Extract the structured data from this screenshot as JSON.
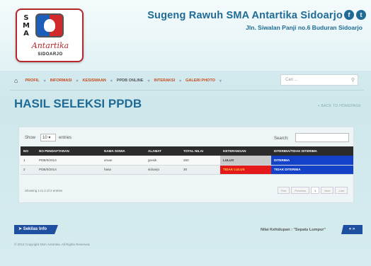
{
  "header": {
    "title": "Sugeng Rawuh SMA Antartika Sidoarjo",
    "address": "Jln. Siwalan Panji no.6 Buduran Sidoarjo",
    "social": [
      "f",
      "t"
    ]
  },
  "logo": {
    "letters": "SMA",
    "script": "Antartika",
    "city": "SIDOARJO"
  },
  "nav": {
    "home_icon": "home-icon",
    "items": [
      "PROFIL",
      "INFORMASI",
      "KESISWAAN",
      "PPDB ONLINE",
      "INTERAKSI",
      "GALERI PHOTO"
    ],
    "search_placeholder": "Cari ..."
  },
  "page": {
    "title": "HASIL SELEKSI PPDB",
    "back_link": "« BACK TO HOMEPAGE"
  },
  "table": {
    "show_label": "Show",
    "show_value": "10",
    "entries_label": "entries",
    "search_label": "Search:",
    "columns": [
      "NO",
      "NO PENDAFTARAN",
      "NAMA SISWA",
      "ALAMAT",
      "TOTAL NILAI",
      "KETERANGAN",
      "DITERIMA/TIDAK DITERIMA"
    ],
    "rows": [
      [
        "1",
        "PDB/0/2014",
        "ervan",
        "gresik",
        "260",
        "LULUS",
        "DITERIMA"
      ],
      [
        "2",
        "PDB/0/2014",
        "hasa",
        "sidoarjo",
        "30",
        "TIDAK LULUS",
        "TIDAK DITERIMA"
      ]
    ],
    "showing": "Showing 1 to 2 of 2 entries",
    "pager": [
      "First",
      "Previous",
      "1",
      "Next",
      "Last"
    ]
  },
  "footer": {
    "button": "Sekilas Info",
    "copyright": "© 2014 Copyright SMA Antartika. All Rights Reserved.",
    "motto": "Nilai Kehidupan : \"Sepatu Lumpur\"",
    "motto_button": "« »"
  },
  "colors": {
    "accent": "#1f6b96",
    "nav_link": "#c84a1c",
    "lulus": "#c9c9c9",
    "tidak_lulus": "#e41a1a",
    "diterima": "#1342c9"
  }
}
